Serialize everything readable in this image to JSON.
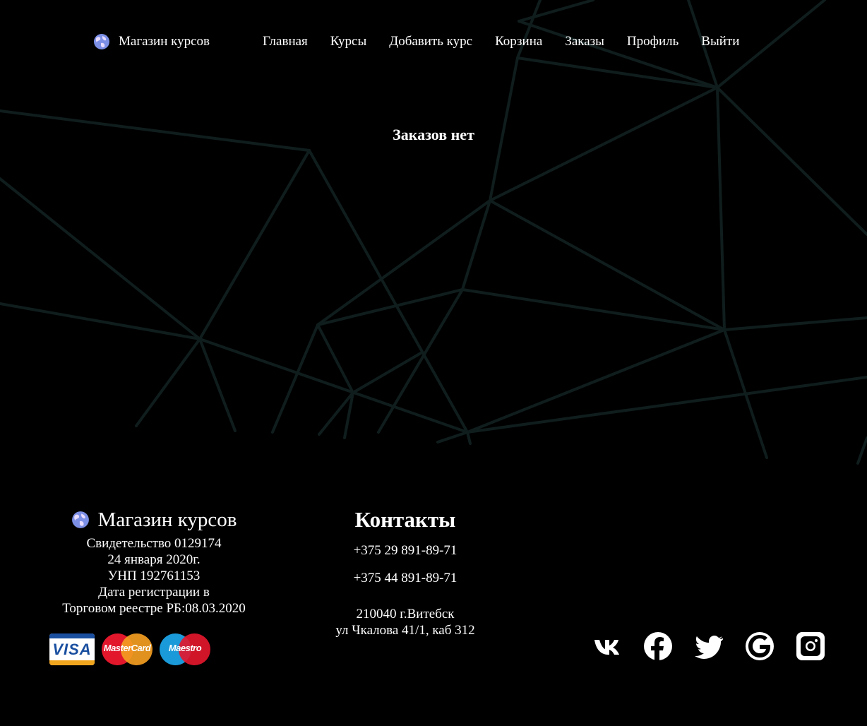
{
  "header": {
    "brand": "Магазин курсов",
    "nav": [
      {
        "label": "Главная"
      },
      {
        "label": "Курсы"
      },
      {
        "label": "Добавить курс"
      },
      {
        "label": "Корзина"
      },
      {
        "label": "Заказы"
      },
      {
        "label": "Профиль"
      },
      {
        "label": "Выйти"
      }
    ]
  },
  "main": {
    "empty_message": "Заказов нет"
  },
  "footer": {
    "brand": "Магазин курсов",
    "company_lines": [
      "Свидетельство 0129174",
      "24 января 2020г.",
      "УНП 192761153",
      "Дата регистрации в",
      "Торговом реестре РБ:08.03.2020"
    ],
    "payments": {
      "visa": "VISA",
      "mastercard": "MasterCard",
      "maestro": "Maestro"
    },
    "contacts": {
      "title": "Контакты",
      "phone1": "+375 29 891-89-71",
      "phone2": "+375 44 891-89-71",
      "address_line1": "210040 г.Витебск",
      "address_line2": "ул Чкалова 41/1, каб 312"
    },
    "social_icons": [
      "vk-icon",
      "facebook-icon",
      "twitter-icon",
      "google-icon",
      "instagram-icon"
    ]
  },
  "colors": {
    "background": "#000000",
    "text": "#ffffff",
    "web_lines": "#101d1d"
  }
}
